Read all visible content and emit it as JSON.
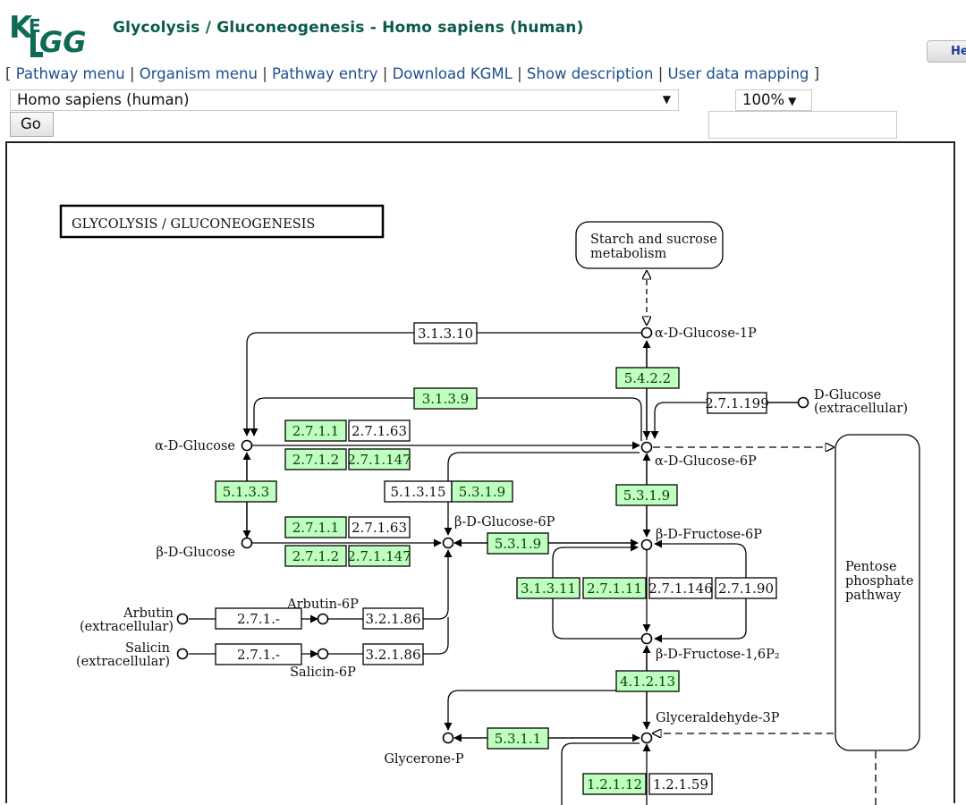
{
  "header": {
    "logo_text": "KEGG",
    "title": "Glycolysis / Gluconeogenesis - Homo sapiens (human)",
    "help_button": "Help"
  },
  "nav": {
    "open_bracket": "[",
    "close_bracket": "]",
    "separator": "|",
    "links": [
      "Pathway menu",
      "Organism menu",
      "Pathway entry",
      "Download KGML",
      "Show description",
      "User data mapping"
    ]
  },
  "controls": {
    "organism_select": "Homo sapiens (human)",
    "zoom_select": "100%",
    "go_button": "Go",
    "search_input_value": "",
    "dropdown_arrow": "▼"
  },
  "colors": {
    "enzyme_present": "#bfffbf",
    "enzyme_absent": "#ffffff",
    "title_green": "#0b5b4a",
    "link_blue": "#1f4f8f"
  },
  "map": {
    "title": "GLYCOLYSIS / GLUCONEOGENESIS",
    "pathways": [
      {
        "id": "starch",
        "lines": [
          "Starch and sucrose",
          "metabolism"
        ]
      },
      {
        "id": "pentose",
        "lines": [
          "Pentose",
          "phosphate",
          "pathway"
        ]
      }
    ],
    "compounds": [
      {
        "id": "a-glc-1p",
        "label": "α-D-Glucose-1P"
      },
      {
        "id": "d-glc-ext",
        "lines": [
          "D-Glucose",
          "(extracellular)"
        ]
      },
      {
        "id": "a-glc",
        "label": "α-D-Glucose"
      },
      {
        "id": "a-glc-6p",
        "label": "α-D-Glucose-6P"
      },
      {
        "id": "b-glc",
        "label": "β-D-Glucose"
      },
      {
        "id": "b-glc-6p",
        "label": "β-D-Glucose-6P"
      },
      {
        "id": "b-fru-6p",
        "label": "β-D-Fructose-6P"
      },
      {
        "id": "b-fru-16p2",
        "label": "β-D-Fructose-1,6P₂"
      },
      {
        "id": "arbutin-ext",
        "lines": [
          "Arbutin",
          "(extracellular)"
        ]
      },
      {
        "id": "arbutin-6p",
        "label": "Arbutin-6P"
      },
      {
        "id": "salicin-ext",
        "lines": [
          "Salicin",
          "(extracellular)"
        ]
      },
      {
        "id": "salicin-6p",
        "label": "Salicin-6P"
      },
      {
        "id": "g3p",
        "label": "Glyceraldehyde-3P"
      },
      {
        "id": "glycerone-p",
        "label": "Glycerone-P"
      }
    ],
    "enzymes": [
      {
        "ec": "3.1.3.10",
        "present": false
      },
      {
        "ec": "5.4.2.2",
        "present": true
      },
      {
        "ec": "3.1.3.9",
        "present": true
      },
      {
        "ec": "2.7.1.199",
        "present": false
      },
      {
        "ec": "2.7.1.1",
        "present": true
      },
      {
        "ec": "2.7.1.63",
        "present": false
      },
      {
        "ec": "2.7.1.2",
        "present": true
      },
      {
        "ec": "2.7.1.147",
        "present": true
      },
      {
        "ec": "5.1.3.3",
        "present": true
      },
      {
        "ec": "5.1.3.15",
        "present": false
      },
      {
        "ec": "5.3.1.9",
        "present": true
      },
      {
        "ec": "5.3.1.9",
        "present": true
      },
      {
        "ec": "5.3.1.9",
        "present": true
      },
      {
        "ec": "2.7.1.1",
        "present": true
      },
      {
        "ec": "2.7.1.63",
        "present": false
      },
      {
        "ec": "2.7.1.2",
        "present": true
      },
      {
        "ec": "2.7.1.147",
        "present": true
      },
      {
        "ec": "3.1.3.11",
        "present": true
      },
      {
        "ec": "2.7.1.11",
        "present": true
      },
      {
        "ec": "2.7.1.146",
        "present": false
      },
      {
        "ec": "2.7.1.90",
        "present": false
      },
      {
        "ec": "2.7.1.-",
        "present": false
      },
      {
        "ec": "3.2.1.86",
        "present": false
      },
      {
        "ec": "2.7.1.-",
        "present": false
      },
      {
        "ec": "3.2.1.86",
        "present": false
      },
      {
        "ec": "4.1.2.13",
        "present": true
      },
      {
        "ec": "5.3.1.1",
        "present": true
      },
      {
        "ec": "1.2.1.12",
        "present": true
      },
      {
        "ec": "1.2.1.59",
        "present": false
      }
    ]
  }
}
